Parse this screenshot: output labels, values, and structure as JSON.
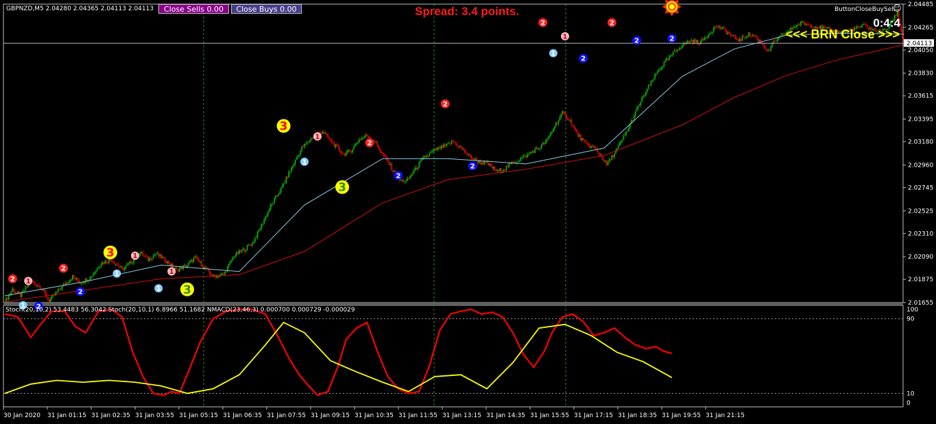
{
  "header": {
    "symbol_info": "GBPNZD,M5  2.04280 2.04365 2.04113 2.04113",
    "close_sells": "Close Sells 0.00",
    "close_buys": "Close Buys 0.00",
    "spread": "Spread: 3.4 points.",
    "ea_name": "ButtonCloseBuySell",
    "ea_icon": "smiley-icon",
    "timer": "0:4:4",
    "brn_close": "<<< BRN Close >>>"
  },
  "indicator_info": "Stoch(20,10,2) 53.4483 56.3042   Stoch(20,10,1) 6.8966 51.1682   NMACD(23,46,3) 0.000700 0.000729 -0.000029",
  "colors": {
    "background": "#000000",
    "bull": "#00c000",
    "bear": "#ff0000",
    "ma_fast": "#87ceeb",
    "ma_slow": "#d01010",
    "stoch_main": "#ff0000",
    "stoch_signal": "#ffff00",
    "grid_vertical": "#2e8b2e",
    "price_line": "#c0c0c0",
    "text": "#ffffff"
  },
  "chart_data": [
    {
      "type": "candlestick",
      "symbol": "GBPNZD",
      "timeframe": "M5",
      "ylim": [
        2.01655,
        2.04485
      ],
      "y_tick_labels": [
        "2.04485",
        "2.04265",
        "2.04050",
        "2.03830",
        "2.03615",
        "2.03395",
        "2.03180",
        "2.02960",
        "2.02745",
        "2.02525",
        "2.02310",
        "2.02090",
        "2.01875",
        "2.01655"
      ],
      "y_ticks": [
        2.04485,
        2.04265,
        2.0405,
        2.0383,
        2.03615,
        2.03395,
        2.0318,
        2.0296,
        2.02745,
        2.02525,
        2.0231,
        2.0209,
        2.01875,
        2.01655
      ],
      "current_price": 2.04113,
      "current_price_label": "2.04113",
      "x_tick_labels": [
        "30 Jan 2020",
        "31 Jan 01:15",
        "31 Jan 02:35",
        "31 Jan 03:55",
        "31 Jan 05:15",
        "31 Jan 06:35",
        "31 Jan 07:55",
        "31 Jan 09:15",
        "31 Jan 10:35",
        "31 Jan 11:55",
        "31 Jan 13:15",
        "31 Jan 14:35",
        "31 Jan 15:55",
        "31 Jan 17:15",
        "31 Jan 18:35",
        "31 Jan 19:55",
        "31 Jan 21:15"
      ],
      "bars": 265,
      "price_path": [
        [
          0,
          2.0166
        ],
        [
          6,
          2.0178
        ],
        [
          12,
          2.0172
        ],
        [
          20,
          2.0186
        ],
        [
          28,
          2.018
        ],
        [
          34,
          2.0167
        ],
        [
          42,
          2.0178
        ],
        [
          52,
          2.019
        ],
        [
          58,
          2.0184
        ],
        [
          66,
          2.019
        ],
        [
          74,
          2.0203
        ],
        [
          82,
          2.0206
        ],
        [
          90,
          2.0197
        ],
        [
          98,
          2.0205
        ],
        [
          104,
          2.0213
        ],
        [
          110,
          2.0206
        ],
        [
          116,
          2.0212
        ],
        [
          124,
          2.0205
        ],
        [
          132,
          2.0196
        ],
        [
          140,
          2.0201
        ],
        [
          146,
          2.0208
        ],
        [
          152,
          2.02
        ],
        [
          160,
          2.019
        ],
        [
          168,
          2.0192
        ],
        [
          176,
          2.021
        ],
        [
          184,
          2.0216
        ],
        [
          190,
          2.0222
        ],
        [
          196,
          2.0236
        ],
        [
          204,
          2.0257
        ],
        [
          212,
          2.0273
        ],
        [
          220,
          2.0293
        ],
        [
          228,
          2.0312
        ],
        [
          236,
          2.0322
        ],
        [
          244,
          2.0328
        ],
        [
          252,
          2.0316
        ],
        [
          260,
          2.0306
        ],
        [
          266,
          2.031
        ],
        [
          272,
          2.032
        ],
        [
          278,
          2.0324
        ],
        [
          284,
          2.0318
        ],
        [
          290,
          2.0306
        ],
        [
          296,
          2.0295
        ],
        [
          302,
          2.0282
        ],
        [
          308,
          2.028
        ],
        [
          314,
          2.029
        ],
        [
          322,
          2.0303
        ],
        [
          330,
          2.031
        ],
        [
          338,
          2.0314
        ],
        [
          344,
          2.0318
        ],
        [
          350,
          2.0312
        ],
        [
          356,
          2.0305
        ],
        [
          362,
          2.03
        ],
        [
          370,
          2.0297
        ],
        [
          378,
          2.029
        ],
        [
          384,
          2.0293
        ],
        [
          390,
          2.0298
        ],
        [
          398,
          2.0303
        ],
        [
          404,
          2.0308
        ],
        [
          410,
          2.0312
        ],
        [
          416,
          2.0319
        ],
        [
          422,
          2.0333
        ],
        [
          428,
          2.0345
        ],
        [
          434,
          2.0338
        ],
        [
          440,
          2.0324
        ],
        [
          446,
          2.0316
        ],
        [
          452,
          2.0312
        ],
        [
          458,
          2.0304
        ],
        [
          462,
          2.0296
        ],
        [
          470,
          2.0311
        ],
        [
          478,
          2.0329
        ],
        [
          486,
          2.0351
        ],
        [
          494,
          2.037
        ],
        [
          502,
          2.0386
        ],
        [
          510,
          2.0398
        ],
        [
          518,
          2.0408
        ],
        [
          526,
          2.0414
        ],
        [
          534,
          2.0412
        ],
        [
          540,
          2.042
        ],
        [
          546,
          2.0428
        ],
        [
          552,
          2.0424
        ],
        [
          558,
          2.0418
        ],
        [
          564,
          2.0414
        ],
        [
          570,
          2.042
        ],
        [
          576,
          2.0418
        ],
        [
          582,
          2.041
        ],
        [
          586,
          2.0403
        ],
        [
          590,
          2.0412
        ],
        [
          598,
          2.042
        ],
        [
          606,
          2.0427
        ],
        [
          612,
          2.0431
        ],
        [
          620,
          2.0428
        ],
        [
          628,
          2.0426
        ],
        [
          636,
          2.0423
        ],
        [
          644,
          2.0421
        ],
        [
          652,
          2.0425
        ],
        [
          660,
          2.0428
        ],
        [
          666,
          2.0424
        ],
        [
          672,
          2.0422
        ],
        [
          678,
          2.0426
        ],
        [
          685,
          2.0441
        ],
        [
          690,
          2.0411
        ]
      ],
      "moving_averages": [
        {
          "name": "MA fast",
          "color": "#87ceeb",
          "path": [
            [
              0,
              2.0172
            ],
            [
              60,
              2.0185
            ],
            [
              120,
              2.0201
            ],
            [
              180,
              2.0195
            ],
            [
              230,
              2.0258
            ],
            [
              290,
              2.0302
            ],
            [
              340,
              2.0302
            ],
            [
              400,
              2.0297
            ],
            [
              460,
              2.0312
            ],
            [
              520,
              2.038
            ],
            [
              560,
              2.0406
            ],
            [
              600,
              2.0419
            ],
            [
              640,
              2.0421
            ],
            [
              690,
              2.042
            ]
          ]
        },
        {
          "name": "MA slow",
          "color": "#d01010",
          "path": [
            [
              0,
              2.0166
            ],
            [
              60,
              2.0177
            ],
            [
              120,
              2.0188
            ],
            [
              180,
              2.0192
            ],
            [
              230,
              2.0214
            ],
            [
              290,
              2.026
            ],
            [
              340,
              2.0282
            ],
            [
              400,
              2.0292
            ],
            [
              460,
              2.0305
            ],
            [
              520,
              2.0334
            ],
            [
              560,
              2.036
            ],
            [
              600,
              2.0381
            ],
            [
              640,
              2.0396
            ],
            [
              690,
              2.041
            ]
          ]
        }
      ],
      "signals": [
        {
          "bar": 6,
          "price": 2.0188,
          "label": "2",
          "kind": "sell2"
        },
        {
          "bar": 18,
          "price": 2.0186,
          "label": "1",
          "kind": "sell1"
        },
        {
          "bar": 14,
          "price": 2.0163,
          "label": "1",
          "kind": "buy1"
        },
        {
          "bar": 26,
          "price": 2.0162,
          "label": "2",
          "kind": "buy2"
        },
        {
          "bar": 45,
          "price": 2.0198,
          "label": "2",
          "kind": "sell2"
        },
        {
          "bar": 58,
          "price": 2.0176,
          "label": "2",
          "kind": "buy2"
        },
        {
          "bar": 81,
          "price": 2.0213,
          "label": "3",
          "kind": "sell3"
        },
        {
          "bar": 86,
          "price": 2.0193,
          "label": "1",
          "kind": "buy1"
        },
        {
          "bar": 100,
          "price": 2.021,
          "label": "1",
          "kind": "sell1"
        },
        {
          "bar": 118,
          "price": 2.0179,
          "label": "1",
          "kind": "buy1"
        },
        {
          "bar": 128,
          "price": 2.0195,
          "label": "1",
          "kind": "sell1"
        },
        {
          "bar": 140,
          "price": 2.0178,
          "label": "3",
          "kind": "buy3"
        },
        {
          "bar": 214,
          "price": 2.0333,
          "label": "3",
          "kind": "sell3"
        },
        {
          "bar": 230,
          "price": 2.0299,
          "label": "1",
          "kind": "buy1"
        },
        {
          "bar": 240,
          "price": 2.0323,
          "label": "1",
          "kind": "sell1"
        },
        {
          "bar": 259,
          "price": 2.0275,
          "label": "3",
          "kind": "buy3"
        },
        {
          "bar": 280,
          "price": 2.0317,
          "label": "2",
          "kind": "sell2"
        },
        {
          "bar": 302,
          "price": 2.0286,
          "label": "2",
          "kind": "buy2"
        },
        {
          "bar": 338,
          "price": 2.0354,
          "label": "2",
          "kind": "sell2"
        },
        {
          "bar": 359,
          "price": 2.0295,
          "label": "2",
          "kind": "buy2"
        },
        {
          "bar": 413,
          "price": 2.0431,
          "label": "2",
          "kind": "sell2"
        },
        {
          "bar": 421,
          "price": 2.0402,
          "label": "1",
          "kind": "buy1"
        },
        {
          "bar": 430,
          "price": 2.0418,
          "label": "1",
          "kind": "sell1"
        },
        {
          "bar": 444,
          "price": 2.0397,
          "label": "2",
          "kind": "buy2"
        },
        {
          "bar": 466,
          "price": 2.0431,
          "label": "2",
          "kind": "sell2"
        },
        {
          "bar": 485,
          "price": 2.0414,
          "label": "2",
          "kind": "buy2"
        },
        {
          "bar": 512,
          "price": 2.0416,
          "label": "2",
          "kind": "buy2"
        },
        {
          "bar": 512,
          "price": 2.0446,
          "label": "O",
          "kind": "exit"
        }
      ]
    },
    {
      "type": "line",
      "title": "Stoch(20,10,2) 53.4483 56.3042   Stoch(20,10,1) 6.8966 51.1682   NMACD(23,46,3) 0.000700 0.000729 -0.000029",
      "ylim": [
        0,
        100
      ],
      "y_tick_labels": [
        "100",
        "90",
        "10",
        "0"
      ],
      "y_ticks": [
        100,
        90,
        10,
        0
      ],
      "levels": [
        90,
        10
      ],
      "series": [
        {
          "name": "Stoch(20,10,1)",
          "color": "#ff0000",
          "x": [
            0,
            10,
            20,
            28,
            36,
            46,
            54,
            62,
            72,
            82,
            90,
            98,
            106,
            114,
            122,
            128,
            134,
            140,
            150,
            160,
            170,
            180,
            190,
            200,
            210,
            218,
            226,
            232,
            240,
            248,
            256,
            262,
            270,
            278,
            286,
            294,
            302,
            310,
            318,
            326,
            334,
            342,
            350,
            358,
            366,
            374,
            382,
            390,
            398,
            406,
            414,
            420,
            428,
            436,
            444,
            452,
            460,
            468,
            476,
            484,
            492,
            500,
            506,
            512
          ],
          "values": [
            95,
            92,
            70,
            85,
            98,
            98,
            82,
            75,
            98,
            100,
            92,
            55,
            28,
            10,
            8,
            12,
            10,
            30,
            65,
            90,
            98,
            100,
            100,
            95,
            70,
            48,
            30,
            20,
            8,
            12,
            40,
            68,
            80,
            86,
            55,
            28,
            15,
            10,
            12,
            40,
            78,
            95,
            98,
            100,
            95,
            97,
            92,
            75,
            52,
            38,
            55,
            75,
            92,
            95,
            87,
            72,
            75,
            80,
            70,
            62,
            58,
            60,
            55,
            53
          ]
        },
        {
          "name": "Stoch(20,10,2)",
          "color": "#ffff00",
          "x": [
            0,
            20,
            40,
            60,
            80,
            100,
            120,
            140,
            160,
            180,
            200,
            214,
            230,
            250,
            270,
            290,
            310,
            330,
            350,
            370,
            390,
            410,
            430,
            450,
            470,
            490,
            512
          ],
          "values": [
            10,
            20,
            24,
            22,
            24,
            22,
            18,
            10,
            15,
            30,
            62,
            86,
            75,
            45,
            33,
            22,
            12,
            28,
            30,
            15,
            43,
            80,
            84,
            72,
            54,
            44,
            27
          ]
        }
      ]
    }
  ]
}
